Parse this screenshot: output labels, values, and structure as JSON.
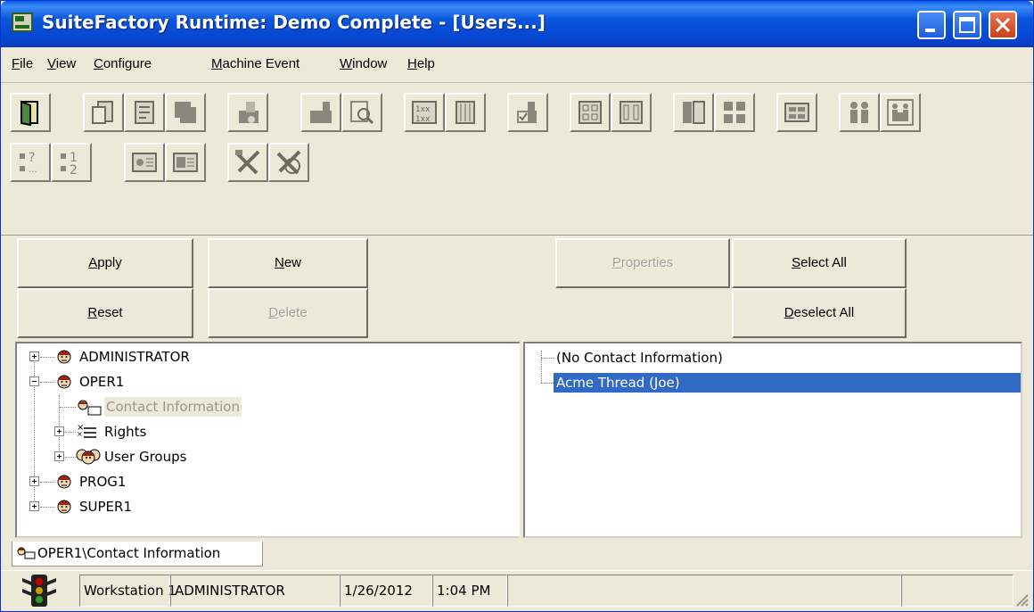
{
  "window": {
    "title": "SuiteFactory Runtime: Demo Complete - [Users...]"
  },
  "menu": {
    "items": [
      {
        "label": "File",
        "mnemonic": "F"
      },
      {
        "label": "View",
        "mnemonic": "V"
      },
      {
        "label": "Configure",
        "mnemonic": "C"
      },
      {
        "label": "Machine Event",
        "mnemonic": "M"
      },
      {
        "label": "Window",
        "mnemonic": "W"
      },
      {
        "label": "Help",
        "mnemonic": "H"
      }
    ]
  },
  "toolbar": {
    "icons": [
      "exit-door-icon",
      "copy-document-icon",
      "paste-document-icon",
      "stack-document-icon",
      "machine-edit-icon",
      "machine-icon",
      "find-icon",
      "grid-xx-icon",
      "list-icon",
      "machine-check-icon",
      "grid-8-icon",
      "grid-6-icon",
      "panel-icon",
      "panel-tiles-icon",
      "panel-stack-icon",
      "users-pair-icon",
      "users-group-icon",
      "help-grid-icon",
      "numbered-list-icon",
      "card-icon",
      "card-alt-icon",
      "tools-icon",
      "tools-cancel-icon"
    ]
  },
  "actions": {
    "apply": "Apply",
    "new": "New",
    "properties": "Properties",
    "select_all": "Select All",
    "reset": "Reset",
    "delete": "Delete",
    "deselect_all": "Deselect All"
  },
  "tree": {
    "nodes": [
      {
        "label": "ADMINISTRATOR"
      },
      {
        "label": "OPER1"
      },
      {
        "label": "Contact Information"
      },
      {
        "label": "Rights"
      },
      {
        "label": "User Groups"
      },
      {
        "label": "PROG1"
      },
      {
        "label": "SUPER1"
      }
    ]
  },
  "list": {
    "items": [
      {
        "label": "(No Contact Information)"
      },
      {
        "label": "Acme Thread (Joe)"
      }
    ]
  },
  "path_tab": {
    "label": "OPER1\\Contact Information"
  },
  "status": {
    "workstation": "Workstation 1",
    "user": "ADMINISTRATOR",
    "date": "1/26/2012",
    "time": "1:04 PM"
  }
}
